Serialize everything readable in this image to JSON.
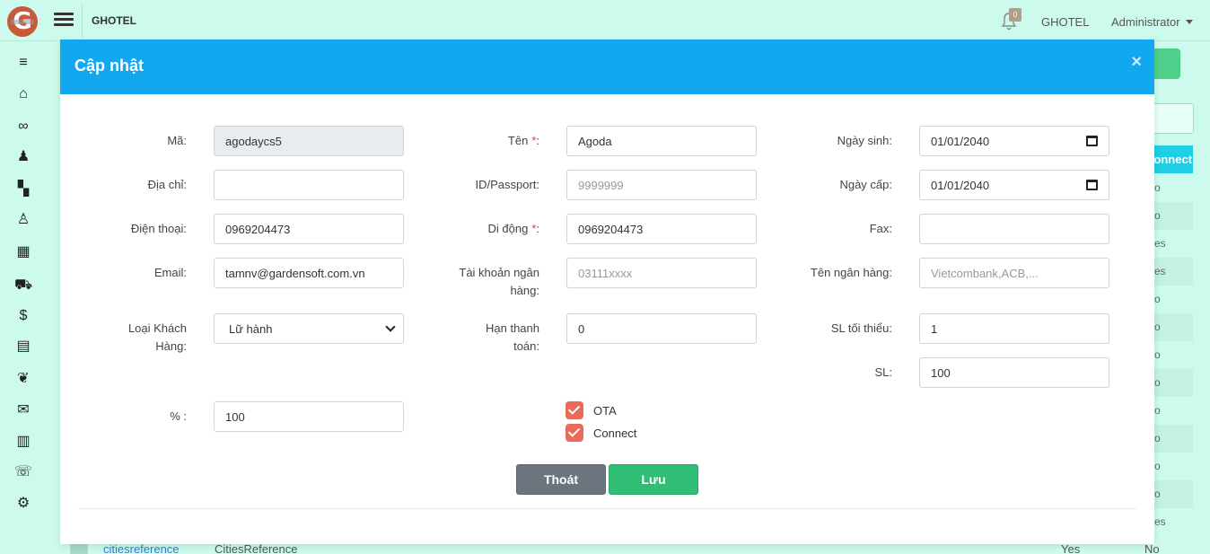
{
  "topbar": {
    "brand": "GHOTEL",
    "notification_count": "0",
    "hotel_label": "GHOTEL",
    "user_label": "Administrator"
  },
  "logo": {
    "letter": "G"
  },
  "sidebar": {
    "items": [
      {
        "icon": "menu-icon",
        "glyph": "≡"
      },
      {
        "icon": "home-icon",
        "glyph": "⌂"
      },
      {
        "icon": "handshake-icon",
        "glyph": "∞"
      },
      {
        "icon": "reception-icon",
        "glyph": "♟"
      },
      {
        "icon": "building-icon",
        "glyph": "▚"
      },
      {
        "icon": "users-icon",
        "glyph": "♙"
      },
      {
        "icon": "grid-icon",
        "glyph": "▦"
      },
      {
        "icon": "cart-icon",
        "glyph": "⛟"
      },
      {
        "icon": "dollar-icon",
        "glyph": "$"
      },
      {
        "icon": "table-icon",
        "glyph": "▤"
      },
      {
        "icon": "leaf-icon",
        "glyph": "❦"
      },
      {
        "icon": "envelope-icon",
        "glyph": "✉"
      },
      {
        "icon": "chart-icon",
        "glyph": "▥"
      },
      {
        "icon": "comments-icon",
        "glyph": "☏"
      },
      {
        "icon": "settings-icon",
        "glyph": "⚙"
      }
    ]
  },
  "background": {
    "header_label": "Connect",
    "column_cells": [
      "o",
      "o",
      "es",
      "es",
      "o",
      "o",
      "o",
      "o",
      "o",
      "o",
      "o",
      "o",
      "es"
    ],
    "row": {
      "code": "citiesreference",
      "name": "CitiesReference",
      "col_a": "Yes",
      "col_b": "No"
    }
  },
  "modal": {
    "title": "Cập nhật",
    "close": "×",
    "fields": {
      "ma": {
        "label": "Mã:",
        "value": "agodaycs5"
      },
      "ten": {
        "label": "Tên",
        "required": "*",
        "suffix": ":",
        "value": "Agoda"
      },
      "ngay_sinh": {
        "label": "Ngày sinh:",
        "value": "01/01/2040"
      },
      "dia_chi": {
        "label": "Địa chỉ:",
        "value": ""
      },
      "passport": {
        "label": "ID/Passport:",
        "placeholder": "9999999"
      },
      "ngay_cap": {
        "label": "Ngày cấp:",
        "value": "01/01/2040"
      },
      "dien_thoai": {
        "label": "Điện thoại:",
        "value": "0969204473"
      },
      "di_dong": {
        "label": "Di động",
        "required": "*",
        "suffix": ":",
        "value": "0969204473"
      },
      "fax": {
        "label": "Fax:",
        "value": ""
      },
      "email": {
        "label": "Email:",
        "value": "tamnv@gardensoft.com.vn"
      },
      "tai_khoan_line1": "Tài khoản ngân",
      "tai_khoan_line2": "hàng:",
      "tai_khoan_placeholder": "03111xxxx",
      "ten_ngan_hang": {
        "label": "Tên ngân hàng:",
        "placeholder": "Vietcombank,ACB,..."
      },
      "loai_kh_line1": "Loại Khách",
      "loai_kh_line2": "Hàng:",
      "loai_kh_value": "Lữ hành",
      "han_tt_line1": "Hạn thanh",
      "han_tt_line2": "toán:",
      "han_tt_value": "0",
      "sl_toi_thieu": {
        "label": "SL tối thiểu:",
        "value": "1"
      },
      "sl": {
        "label": "SL:",
        "value": "100"
      },
      "percent": {
        "label": "% :",
        "value": "100"
      }
    },
    "checkboxes": {
      "ota": "OTA",
      "connect": "Connect"
    },
    "buttons": {
      "exit": "Thoát",
      "save": "Lưu"
    }
  },
  "colors": {
    "header_blue": "#13a7f0",
    "save_green": "#2fbe74",
    "checkbox_red": "#ea6b5c",
    "page_mint": "#ccfbed"
  }
}
